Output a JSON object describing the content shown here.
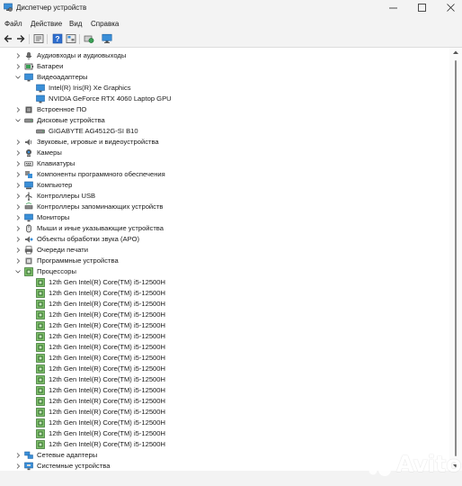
{
  "window": {
    "title": "Диспетчер устройств",
    "controls": {
      "minimize_icon": "minimize-icon",
      "maximize_icon": "maximize-icon",
      "close_icon": "close-icon"
    }
  },
  "menu": [
    "Файл",
    "Действие",
    "Вид",
    "Справка"
  ],
  "toolbar": [
    "back-icon",
    "forward-icon",
    "properties-icon",
    "help-icon",
    "device-view-icon",
    "scan-hardware-icon",
    "monitor-icon"
  ],
  "tree": [
    {
      "label": "Аудиовходы и аудиовыходы",
      "icon": "audio-icon",
      "level": 0,
      "expandable": true,
      "expanded": false
    },
    {
      "label": "Батареи",
      "icon": "battery-icon",
      "level": 0,
      "expandable": true,
      "expanded": false
    },
    {
      "label": "Видеоадаптеры",
      "icon": "display-adapter-icon",
      "level": 0,
      "expandable": true,
      "expanded": true
    },
    {
      "label": "Intel(R) Iris(R) Xe Graphics",
      "icon": "display-adapter-icon",
      "level": 1,
      "expandable": false
    },
    {
      "label": "NVIDIA GeForce RTX 4060 Laptop GPU",
      "icon": "display-adapter-icon",
      "level": 1,
      "expandable": false
    },
    {
      "label": "Встроенное ПО",
      "icon": "firmware-icon",
      "level": 0,
      "expandable": true,
      "expanded": false
    },
    {
      "label": "Дисковые устройства",
      "icon": "disk-icon",
      "level": 0,
      "expandable": true,
      "expanded": true
    },
    {
      "label": "GIGABYTE AG4512G-SI B10",
      "icon": "disk-icon",
      "level": 1,
      "expandable": false
    },
    {
      "label": "Звуковые, игровые и видеоустройства",
      "icon": "sound-icon",
      "level": 0,
      "expandable": true,
      "expanded": false
    },
    {
      "label": "Камеры",
      "icon": "camera-icon",
      "level": 0,
      "expandable": true,
      "expanded": false
    },
    {
      "label": "Клавиатуры",
      "icon": "keyboard-icon",
      "level": 0,
      "expandable": true,
      "expanded": false
    },
    {
      "label": "Компоненты программного обеспечения",
      "icon": "software-component-icon",
      "level": 0,
      "expandable": true,
      "expanded": false
    },
    {
      "label": "Компьютер",
      "icon": "computer-icon",
      "level": 0,
      "expandable": true,
      "expanded": false
    },
    {
      "label": "Контроллеры USB",
      "icon": "usb-icon",
      "level": 0,
      "expandable": true,
      "expanded": false
    },
    {
      "label": "Контроллеры запоминающих устройств",
      "icon": "storage-controller-icon",
      "level": 0,
      "expandable": true,
      "expanded": false
    },
    {
      "label": "Мониторы",
      "icon": "monitor-icon",
      "level": 0,
      "expandable": true,
      "expanded": false
    },
    {
      "label": "Мыши и иные указывающие устройства",
      "icon": "mouse-icon",
      "level": 0,
      "expandable": true,
      "expanded": false
    },
    {
      "label": "Объекты обработки звука (APO)",
      "icon": "audio-processing-icon",
      "level": 0,
      "expandable": true,
      "expanded": false
    },
    {
      "label": "Очереди печати",
      "icon": "printer-icon",
      "level": 0,
      "expandable": true,
      "expanded": false
    },
    {
      "label": "Программные устройства",
      "icon": "software-device-icon",
      "level": 0,
      "expandable": true,
      "expanded": false
    },
    {
      "label": "Процессоры",
      "icon": "processor-icon",
      "level": 0,
      "expandable": true,
      "expanded": true
    },
    {
      "label": "12th Gen Intel(R) Core(TM) i5-12500H",
      "icon": "processor-icon",
      "level": 1,
      "expandable": false
    },
    {
      "label": "12th Gen Intel(R) Core(TM) i5-12500H",
      "icon": "processor-icon",
      "level": 1,
      "expandable": false
    },
    {
      "label": "12th Gen Intel(R) Core(TM) i5-12500H",
      "icon": "processor-icon",
      "level": 1,
      "expandable": false
    },
    {
      "label": "12th Gen Intel(R) Core(TM) i5-12500H",
      "icon": "processor-icon",
      "level": 1,
      "expandable": false
    },
    {
      "label": "12th Gen Intel(R) Core(TM) i5-12500H",
      "icon": "processor-icon",
      "level": 1,
      "expandable": false
    },
    {
      "label": "12th Gen Intel(R) Core(TM) i5-12500H",
      "icon": "processor-icon",
      "level": 1,
      "expandable": false
    },
    {
      "label": "12th Gen Intel(R) Core(TM) i5-12500H",
      "icon": "processor-icon",
      "level": 1,
      "expandable": false
    },
    {
      "label": "12th Gen Intel(R) Core(TM) i5-12500H",
      "icon": "processor-icon",
      "level": 1,
      "expandable": false
    },
    {
      "label": "12th Gen Intel(R) Core(TM) i5-12500H",
      "icon": "processor-icon",
      "level": 1,
      "expandable": false
    },
    {
      "label": "12th Gen Intel(R) Core(TM) i5-12500H",
      "icon": "processor-icon",
      "level": 1,
      "expandable": false
    },
    {
      "label": "12th Gen Intel(R) Core(TM) i5-12500H",
      "icon": "processor-icon",
      "level": 1,
      "expandable": false
    },
    {
      "label": "12th Gen Intel(R) Core(TM) i5-12500H",
      "icon": "processor-icon",
      "level": 1,
      "expandable": false
    },
    {
      "label": "12th Gen Intel(R) Core(TM) i5-12500H",
      "icon": "processor-icon",
      "level": 1,
      "expandable": false
    },
    {
      "label": "12th Gen Intel(R) Core(TM) i5-12500H",
      "icon": "processor-icon",
      "level": 1,
      "expandable": false
    },
    {
      "label": "12th Gen Intel(R) Core(TM) i5-12500H",
      "icon": "processor-icon",
      "level": 1,
      "expandable": false
    },
    {
      "label": "12th Gen Intel(R) Core(TM) i5-12500H",
      "icon": "processor-icon",
      "level": 1,
      "expandable": false
    },
    {
      "label": "Сетевые адаптеры",
      "icon": "network-adapter-icon",
      "level": 0,
      "expandable": true,
      "expanded": false
    },
    {
      "label": "Системные устройства",
      "icon": "system-device-icon",
      "level": 0,
      "expandable": true,
      "expanded": false
    }
  ],
  "watermark": {
    "text": "Avito",
    "icon": "avito-logo-icon",
    "color": "#ffffff"
  },
  "colors": {
    "chrome": "#f3f3f3",
    "content": "#ffffff",
    "text": "#1a1a1a",
    "accent": "#0067c0"
  }
}
